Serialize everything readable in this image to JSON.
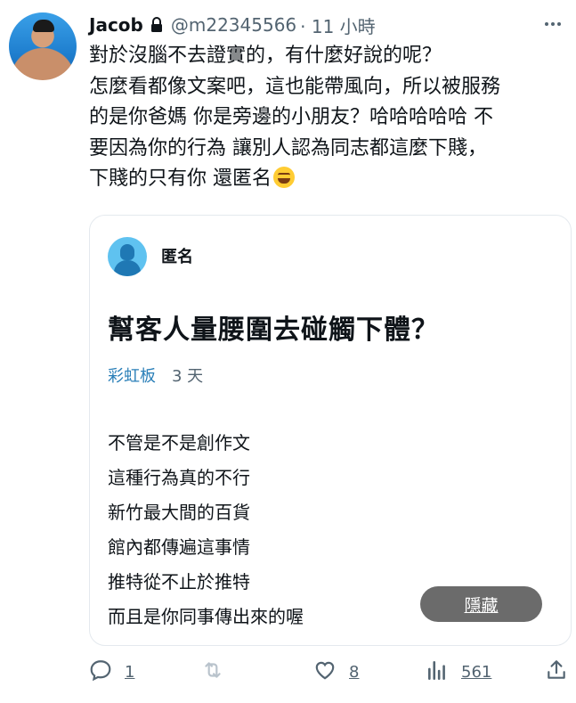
{
  "tweet": {
    "author": {
      "name": "Jacob",
      "handle": "@m22345566",
      "time": "· 11 小時",
      "locked": true
    },
    "text_lines": [
      "對於沒腦不去證實的，有什麼好說的呢？",
      "怎麼看都像文案吧，這也能帶風向，所以被服務",
      "的是你爸媽 你是旁邊的小朋友？哈哈哈哈哈 不",
      "要因為你的行為 讓別人認為同志都這麼下賤，",
      "下賤的只有你 還匿名"
    ],
    "emoji_icon": "rofl-emoji"
  },
  "quoted_card": {
    "author": "匿名",
    "title": "幫客人量腰圍去碰觸下體？",
    "board": "彩虹板",
    "age": "3 天",
    "content_lines": [
      "不管是不是創作文",
      "這種行為真的不行",
      "新竹最大間的百貨",
      "館內都傳遍這事情",
      "推特從不止於推特",
      "而且是你同事傳出來的喔"
    ],
    "hide_button": "隱藏"
  },
  "actions": {
    "reply_count": "1",
    "like_count": "8",
    "views_count": "561"
  },
  "icons": [
    "lock-icon",
    "more-icon",
    "reply-icon",
    "retweet-icon",
    "like-icon",
    "views-icon",
    "share-icon"
  ]
}
